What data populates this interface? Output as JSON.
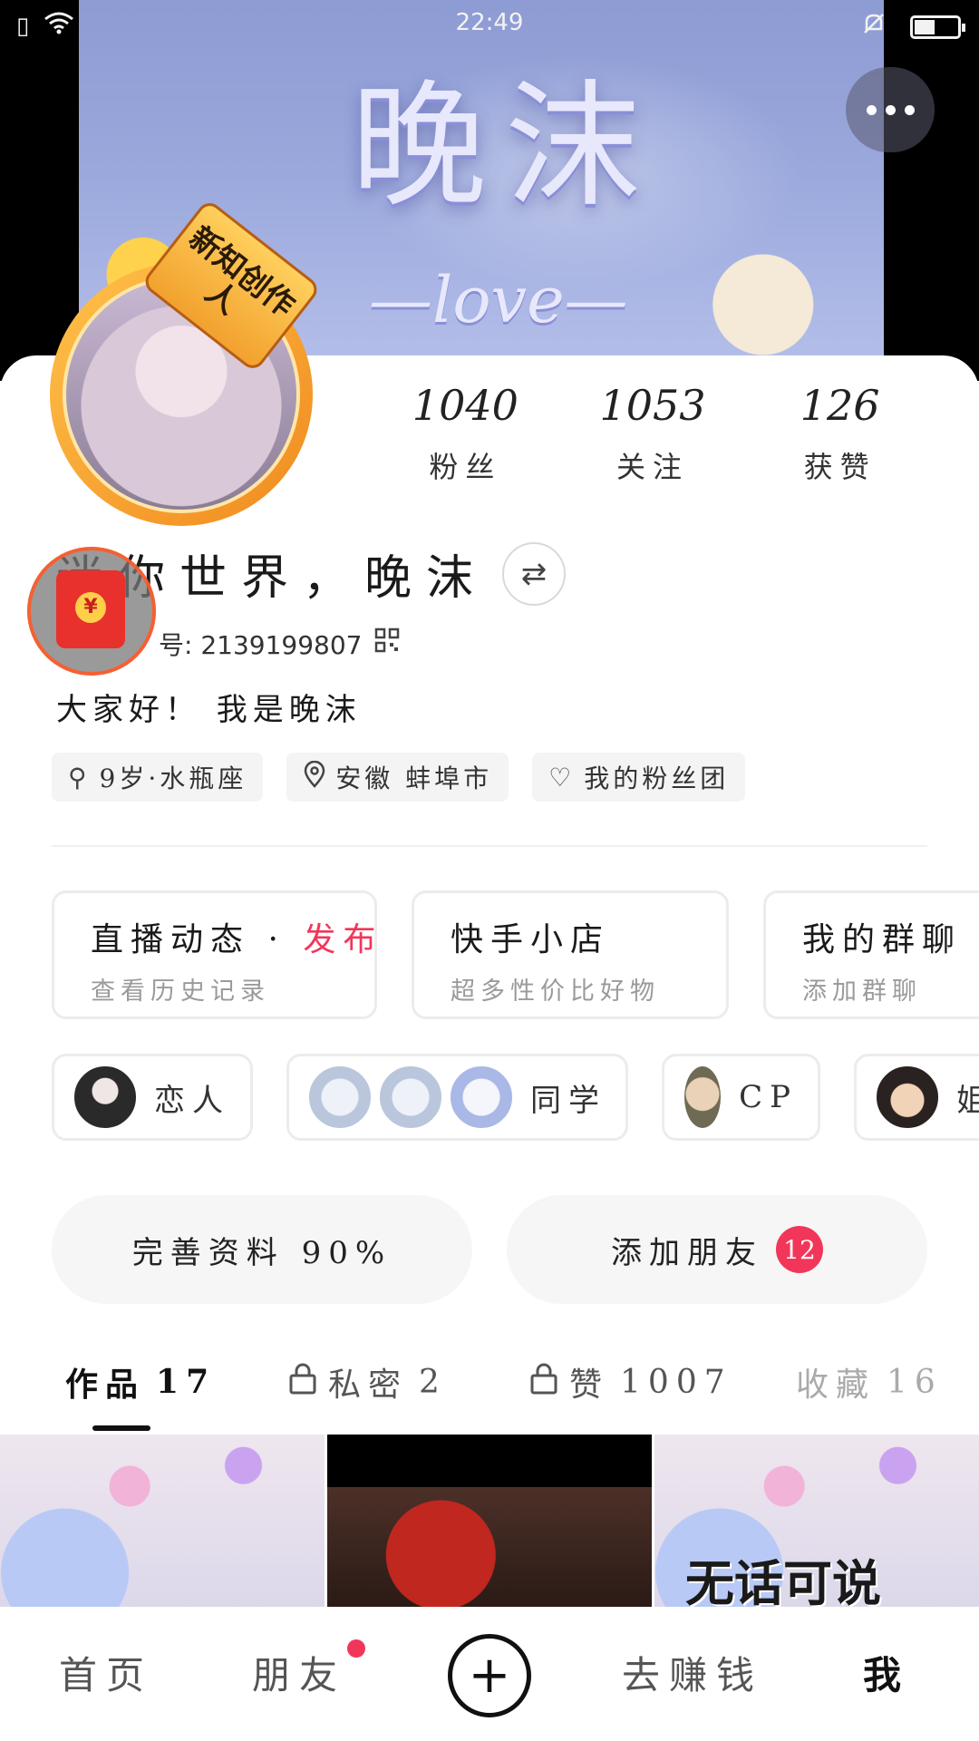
{
  "status_bar": {
    "time": "22:49"
  },
  "banner": {
    "title": "晚沫",
    "subtitle": "—love—"
  },
  "profile": {
    "badge": "新知创作人",
    "stats": [
      {
        "value": "1040",
        "label": "粉丝"
      },
      {
        "value": "1053",
        "label": "关注"
      },
      {
        "value": "126",
        "label": "获赞"
      }
    ],
    "nickname": "迷你世界，晚沫",
    "id_label": "号: 2139199807",
    "bio": "大家好！ 我是晚沫",
    "tags": [
      {
        "icon": "gender-icon",
        "label": "9岁·水瓶座"
      },
      {
        "icon": "location-icon",
        "label": "安徽 蚌埠市"
      },
      {
        "icon": "heart-icon",
        "label": "我的粉丝团"
      }
    ]
  },
  "feature_cards": [
    {
      "title": "直播动态 · ",
      "accent": "发布",
      "subtitle": "查看历史记录"
    },
    {
      "title": "快手小店",
      "accent": "",
      "subtitle": "超多性价比好物"
    },
    {
      "title": "我的群聊",
      "accent": "",
      "subtitle": "添加群聊"
    }
  ],
  "relations": [
    {
      "label": "恋人"
    },
    {
      "label": "同学"
    },
    {
      "label": "CP"
    },
    {
      "label": "姐"
    }
  ],
  "actions": {
    "complete_profile": "完善资料 90%",
    "add_friends": "添加朋友",
    "add_friends_count": "12"
  },
  "tabs": [
    {
      "label": "作品",
      "count": "17"
    },
    {
      "label": "私密",
      "count": "2"
    },
    {
      "label": "赞",
      "count": "1007"
    },
    {
      "label": "收藏",
      "count": "16"
    }
  ],
  "thumbnails": {
    "caption": "无话可说"
  },
  "bottom_nav": {
    "home": "首页",
    "friends": "朋友",
    "earn": "去赚钱",
    "me": "我"
  },
  "colors": {
    "accent": "#f2365a",
    "badge_orange": "#f2a12e"
  }
}
